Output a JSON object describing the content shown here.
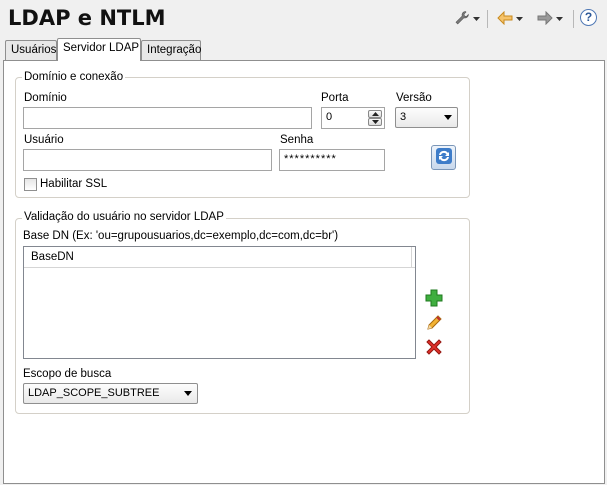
{
  "window": {
    "title": "LDAP e NTLM"
  },
  "toolbar": {
    "tools_icon": "wrench-icon",
    "back_icon": "back-arrow-icon",
    "forward_icon": "forward-arrow-icon",
    "help_label": "?"
  },
  "tabs": [
    {
      "label": "Usuários",
      "active": false
    },
    {
      "label": "Servidor LDAP",
      "active": true
    },
    {
      "label": "Integração",
      "active": false
    }
  ],
  "connection": {
    "title": "Domínio e conexão",
    "domain_label": "Domínio",
    "domain_value": "",
    "port_label": "Porta",
    "port_value": "0",
    "version_label": "Versão",
    "version_value": "3",
    "user_label": "Usuário",
    "user_value": "",
    "password_label": "Senha",
    "password_value": "**********",
    "ssl_label": "Habilitar SSL",
    "ssl_checked": false,
    "test_icon": "refresh-connection-icon"
  },
  "validation": {
    "title": "Validação do usuário no servidor LDAP",
    "basedn_hint": "Base DN (Ex: 'ou=grupousuarios,dc=exemplo,dc=com,dc=br')",
    "list_header": "BaseDN",
    "rows": [],
    "add_icon": "add-icon",
    "edit_icon": "edit-pencil-icon",
    "remove_icon": "delete-icon",
    "scope_label": "Escopo de busca",
    "scope_value": "LDAP_SCOPE_SUBTREE"
  },
  "colors": {
    "add": "#2e9e2e",
    "remove": "#d9261c",
    "edit": "#e8a020",
    "nav_arrow": "#f0b040"
  }
}
